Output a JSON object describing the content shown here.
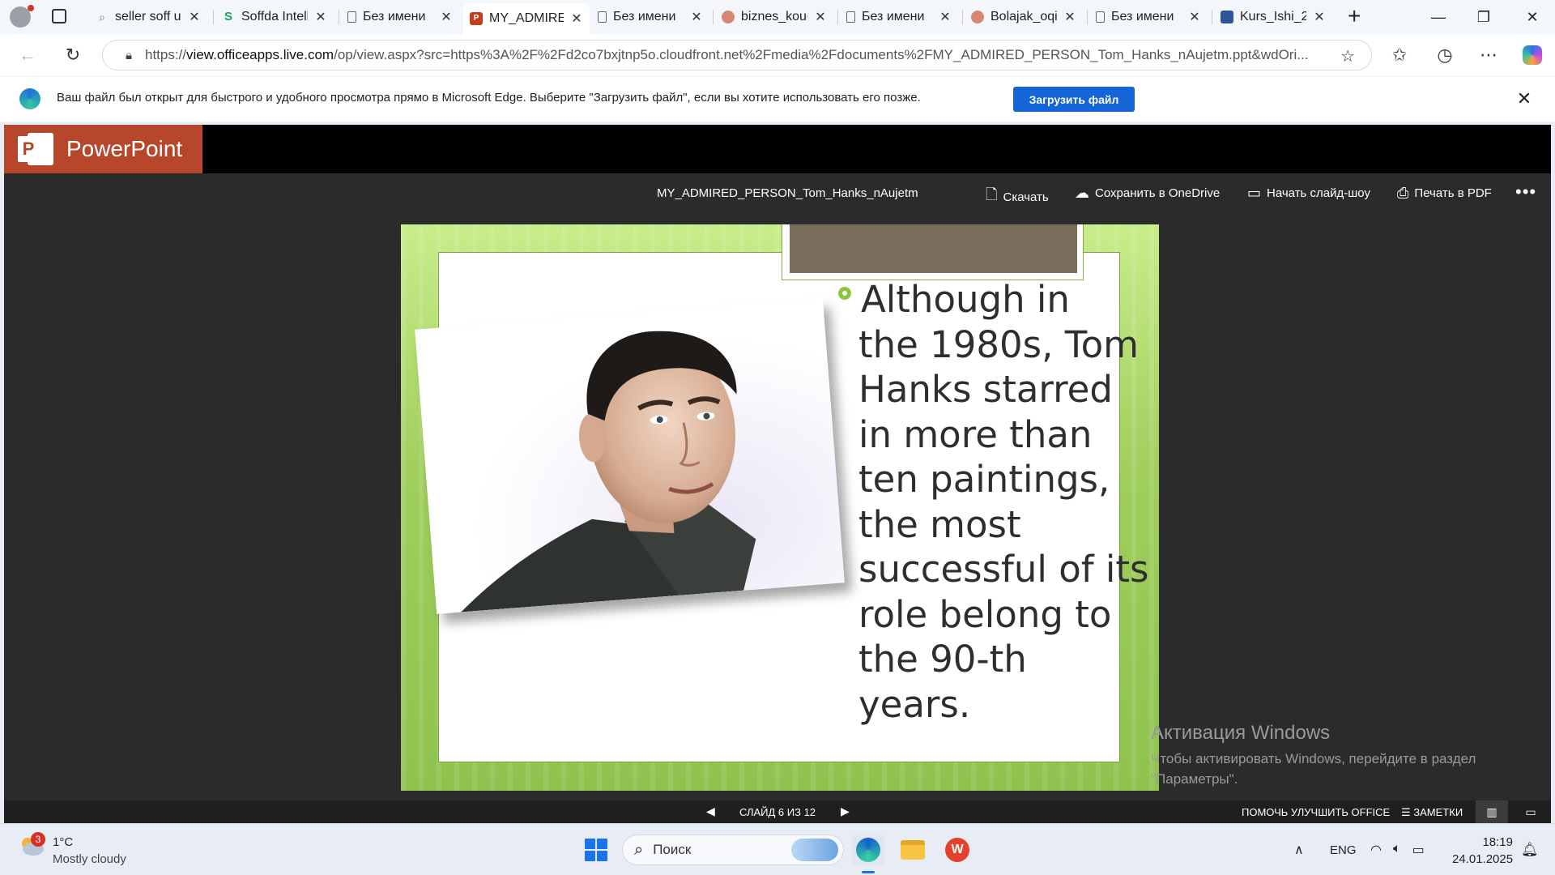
{
  "browser": {
    "tabs": [
      {
        "title": "seller soff u...",
        "favicon": "search-icon",
        "active": false
      },
      {
        "title": "Soffda Intelli",
        "favicon": "soffda-icon",
        "active": false
      },
      {
        "title": "Без имени",
        "favicon": "document-icon",
        "active": false
      },
      {
        "title": "MY_ADMIRED",
        "favicon": "powerpoint-icon",
        "active": true
      },
      {
        "title": "Без имени",
        "favicon": "document-icon",
        "active": false
      },
      {
        "title": "biznes_koug",
        "favicon": "powerpoint-icon",
        "active": false
      },
      {
        "title": "Без имени",
        "favicon": "document-icon",
        "active": false
      },
      {
        "title": "Bolajak_oqi",
        "favicon": "powerpoint-icon",
        "active": false
      },
      {
        "title": "Без имени",
        "favicon": "document-icon",
        "active": false
      },
      {
        "title": "Kurs_Ishi_2",
        "favicon": "word-icon",
        "active": false
      }
    ],
    "new_tab": "+",
    "url_host": "view.officeapps.live.com",
    "url_prefix": "https://",
    "url_rest": "/op/view.aspx?src=https%3A%2F%2Fd2co7bxjtnp5o.cloudfront.net%2Fmedia%2Fdocuments%2FMY_ADMIRED_PERSON_Tom_Hanks_nAujetm.ppt&wdOri..."
  },
  "infobar": {
    "text": "Ваш файл был открыт для быстрого и удобного просмотра прямо в Microsoft Edge. Выберите \"Загрузить файл\", если вы хотите использовать его позже.",
    "button": "Загрузить файл"
  },
  "app": {
    "name": "PowerPoint",
    "doc_title": "MY_ADMIRED_PERSON_Tom_Hanks_nAujetm",
    "commands": {
      "download": "Скачать",
      "save_onedrive": "Сохранить в OneDrive",
      "slideshow": "Начать слайд-шоу",
      "print_pdf": "Печать в PDF"
    }
  },
  "slide": {
    "bullet_lines": [
      "Although in",
      "the 1980s, Tom",
      "Hanks starred",
      "in more than",
      "ten paintings,",
      "the most",
      "successful of its",
      "role belong to",
      "the 90-th",
      "years."
    ]
  },
  "watermark": {
    "title": "Активация Windows",
    "body": "Чтобы активировать Windows, перейдите в раздел \"Параметры\"."
  },
  "statusbar": {
    "slide_label": "СЛАЙД 6 ИЗ 12",
    "help": "ПОМОЧЬ УЛУЧШИТЬ OFFICE",
    "notes": "ЗАМЕТКИ"
  },
  "taskbar": {
    "weather_badge": "3",
    "weather_temp": "1°C",
    "weather_desc": "Mostly cloudy",
    "search_label": "Поиск",
    "lang": "ENG",
    "time": "18:19",
    "date": "24.01.2025"
  }
}
